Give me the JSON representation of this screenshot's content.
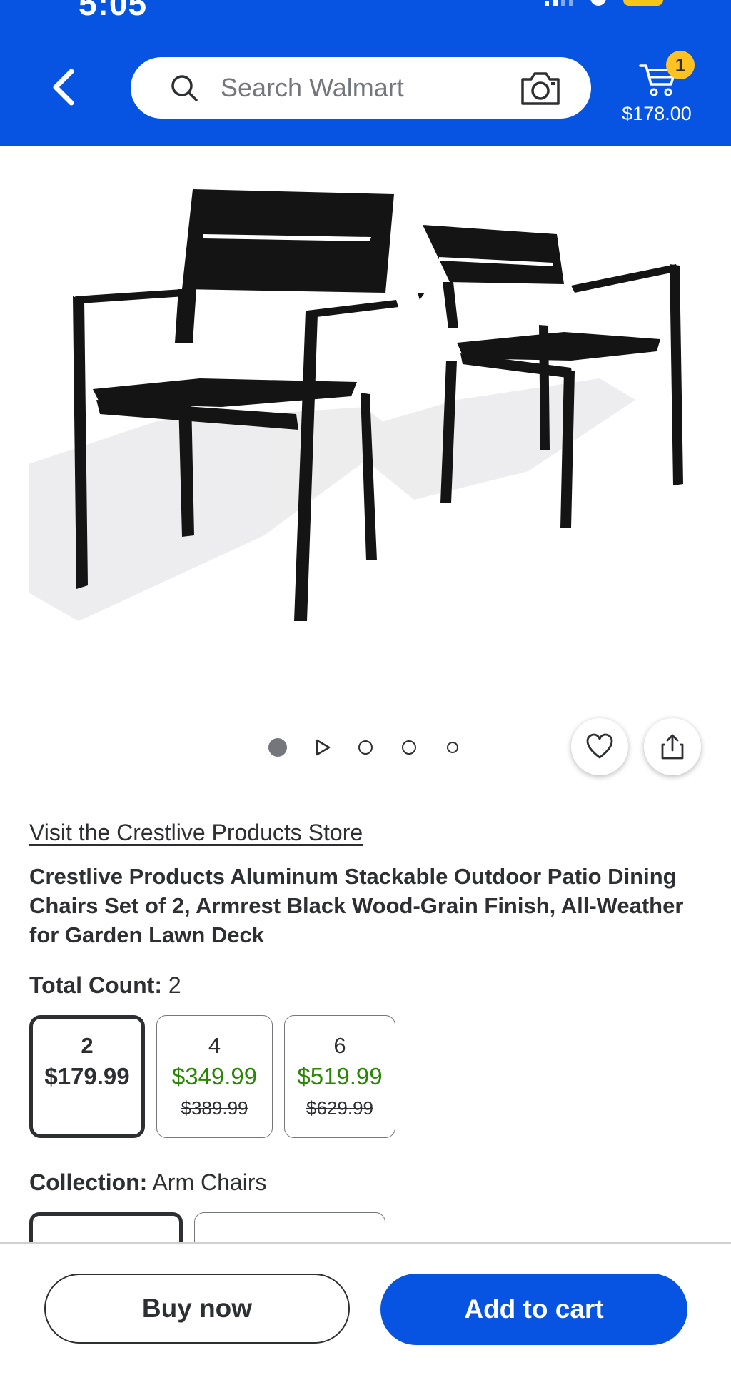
{
  "status_bar": {
    "time": "5:05"
  },
  "header": {
    "background": "#0654e1",
    "search": {
      "placeholder": "Search Walmart"
    },
    "cart": {
      "count": "1",
      "total": "$178.00"
    }
  },
  "icons": {
    "back": "chevron-left-icon",
    "search": "search-icon",
    "camera": "camera-icon",
    "cart": "cart-icon",
    "favorite": "heart-icon",
    "share": "share-icon"
  },
  "gallery": {
    "alt": "Two black aluminum slatted patio armchairs",
    "indicators": [
      "image",
      "video",
      "image",
      "image",
      "image"
    ],
    "active_index": 0
  },
  "product": {
    "store_link": "Visit the Crestlive Products Store",
    "title": "Crestlive Products Aluminum Stackable Outdoor Patio Dining Chairs Set of 2, Armrest Black Wood-Grain Finish, All-Weather for Garden Lawn Deck"
  },
  "total_count": {
    "label": "Total Count:",
    "value": "2",
    "options": [
      {
        "count": "2",
        "price": "$179.99",
        "was": "",
        "selected": true
      },
      {
        "count": "4",
        "price": "$349.99",
        "was": "$389.99",
        "selected": false
      },
      {
        "count": "6",
        "price": "$519.99",
        "was": "$629.99",
        "selected": false
      }
    ]
  },
  "collection": {
    "label": "Collection:",
    "value": "Arm Chairs"
  },
  "actions": {
    "buy_now": "Buy now",
    "add_to_cart": "Add to cart"
  },
  "colors": {
    "brand_blue": "#0654e1",
    "price_green": "#2a8703",
    "badge_yellow": "#ffc220"
  }
}
